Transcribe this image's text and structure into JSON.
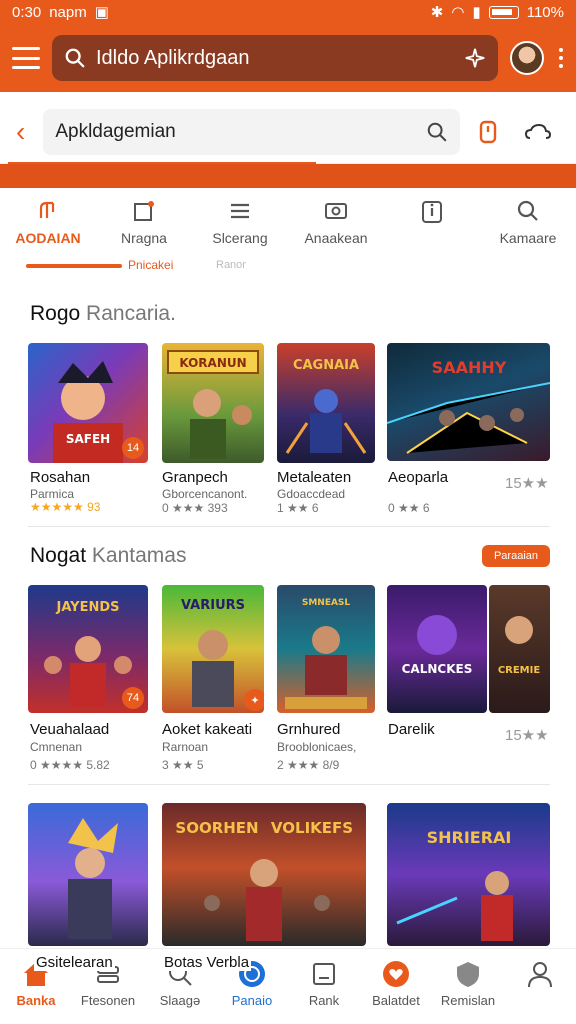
{
  "status_bar": {
    "time": "0:30",
    "carrier": "napm",
    "battery": "110%"
  },
  "app_bar": {
    "search_text": "Idldo Aplikrdgaan"
  },
  "sub_bar": {
    "search_text": "Apkldagemian"
  },
  "categories": [
    {
      "label": "AODAIAN",
      "icon": "game-icon"
    },
    {
      "label": "Nragna",
      "icon": "edit-icon"
    },
    {
      "label": "Slcerang",
      "icon": "list-icon"
    },
    {
      "label": "Anaakean",
      "icon": "image-icon"
    },
    {
      "label": "",
      "icon": "info-icon"
    },
    {
      "label": "Kamaare",
      "icon": "search-icon"
    }
  ],
  "tab_sub": {
    "active": "Pnicakei",
    "inactive": "Ranor"
  },
  "section1": {
    "title": "Rogo",
    "subtitle": "Rancaria.",
    "items": [
      {
        "title": "Rosahan",
        "sub": "Parmica",
        "rating": "★★★★★ 93",
        "badge": "14"
      },
      {
        "title": "Granpech",
        "sub": "Gborcencanont.",
        "rating": "0 ★★★ 393"
      },
      {
        "title": "Metaleaten",
        "sub": "Gdoaccdead",
        "rating": "1 ★★ 6"
      },
      {
        "title": "Aeoparla",
        "sub": "",
        "rating": "0 ★★ 6",
        "side": "15★★"
      }
    ]
  },
  "section2": {
    "title": "Nogat",
    "subtitle": "Kantamas",
    "more": "Paraaian",
    "items": [
      {
        "title": "Veuahalaad",
        "sub": "Cmnenan",
        "rating": "0 ★★★★ 5.82",
        "badge": "74"
      },
      {
        "title": "Aoket kakeati",
        "sub": "Rarnoan",
        "rating": "3 ★★ 5"
      },
      {
        "title": "Grnhured",
        "sub": "Brooblonicaes,",
        "rating": "2 ★★★ 8/9"
      },
      {
        "title": "Darelik",
        "sub": "",
        "rating": "",
        "side": "15★★"
      }
    ]
  },
  "section3": {
    "items": [
      {
        "title": "Gsitelearan"
      },
      {
        "title": "Botas Verbla"
      }
    ]
  },
  "card_art": {
    "c1": "SAFEH",
    "c2": "KORANUN",
    "c3": "CAGNAIA",
    "c4": "SAAHHY",
    "c5": "JAYENDS",
    "c6": "VARIURS",
    "c7": "SMNEASL",
    "c8": "CALNCKES",
    "c8b": "CREMIE",
    "c10": "SOORHEN",
    "c10b": "VOLIKEFS",
    "c11": "SHRIERAI"
  },
  "bottom_nav": [
    {
      "label": "Banka",
      "icon": "home-icon"
    },
    {
      "label": "Ftesonen",
      "icon": "stack-icon"
    },
    {
      "label": "Slaagə",
      "icon": "search-icon"
    },
    {
      "label": "Panaio",
      "icon": "compass-icon"
    },
    {
      "label": "Rank",
      "icon": "card-icon"
    },
    {
      "label": "Balatdet",
      "icon": "heart-icon"
    },
    {
      "label": "Remislan",
      "icon": "shield-icon"
    },
    {
      "label": "",
      "icon": "profile-icon"
    }
  ],
  "colors": {
    "accent": "#e85a1c",
    "active_blue": "#1e6fd6"
  }
}
